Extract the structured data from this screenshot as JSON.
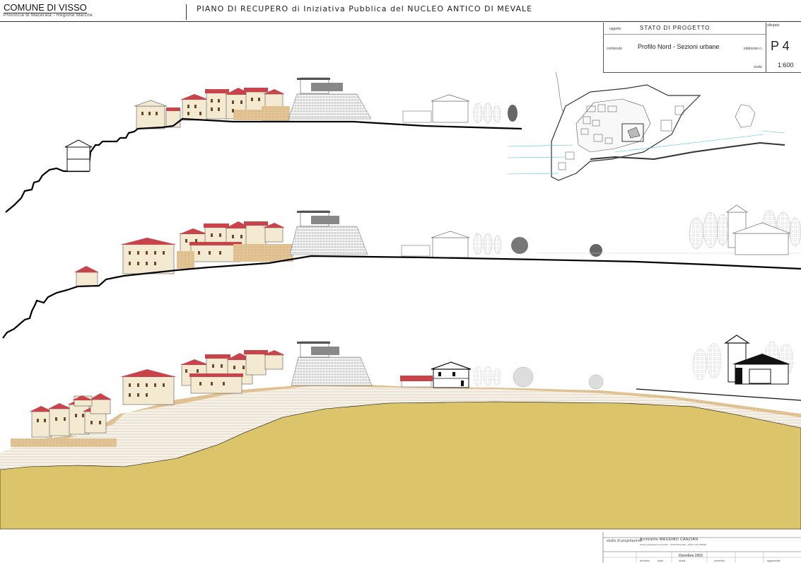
{
  "header": {
    "municipality": "COMUNE DI VISSO",
    "province": "Provincia di Macerata - Regione Marche",
    "title": "PIANO DI RECUPERO di Iniziativa Pubblica del NUCLEO ANTICO DI MEVALE"
  },
  "titleblock": {
    "allegato_label": "allegato",
    "oggetto_label": "oggetto",
    "oggetto_value": "STATO DI PROGETTO",
    "contenuto_label": "contenuto",
    "contenuto_value": "Profilo Nord - Sezioni urbane",
    "elaborato_label": "elaborato n.",
    "elaborato_value": "P 4",
    "scala_label": "scala",
    "scala_value": "1:600"
  },
  "footer": {
    "studio_label": "studio di progettazione",
    "architect": "Architetto MASSIMO CANZIAN",
    "address": "Studio progettazione architetto - 62100 Macerata - tel/fax 0733 000000",
    "date": "Dicembre 2003",
    "cols": [
      "archivio",
      "data",
      "scala",
      "controllo",
      "aggiornato"
    ]
  },
  "colors": {
    "roof": "#c8444a",
    "wall": "#f4ead2",
    "stone": "#e2c394",
    "soil": "#dcc46a",
    "ground_line": "#000000",
    "cyan": "#46c3d2"
  }
}
